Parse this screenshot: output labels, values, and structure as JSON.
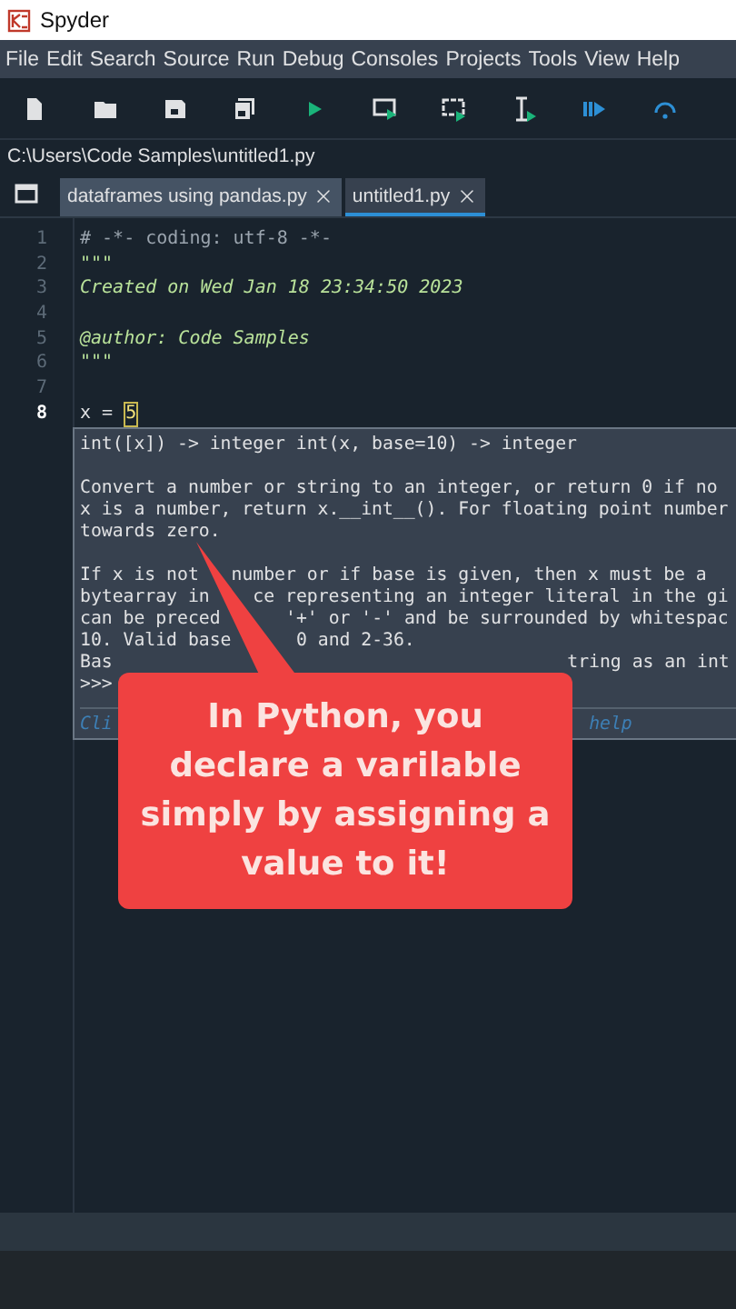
{
  "window": {
    "title": "Spyder"
  },
  "menu": [
    "File",
    "Edit",
    "Search",
    "Source",
    "Run",
    "Debug",
    "Consoles",
    "Projects",
    "Tools",
    "View",
    "Help"
  ],
  "toolbar": [
    {
      "kind": "new-file"
    },
    {
      "kind": "open"
    },
    {
      "kind": "save"
    },
    {
      "kind": "save-all"
    },
    {
      "kind": "run"
    },
    {
      "kind": "run-cell"
    },
    {
      "kind": "run-cell-advance"
    },
    {
      "kind": "run-selection"
    },
    {
      "kind": "debug"
    },
    {
      "kind": "step"
    }
  ],
  "path": "C:\\Users\\Code Samples\\untitled1.py",
  "tabs": [
    {
      "label": "dataframes using pandas.py",
      "selected": false
    },
    {
      "label": "untitled1.py",
      "selected": true
    }
  ],
  "editor": {
    "lines": [
      {
        "number": "1",
        "current": false,
        "tokens": [
          {
            "kind": "comment",
            "text": "# -*- coding: utf-8 -*-"
          }
        ]
      },
      {
        "number": "2",
        "current": false,
        "tokens": [
          {
            "kind": "docstring",
            "text": "\"\"\""
          }
        ]
      },
      {
        "number": "3",
        "current": false,
        "tokens": [
          {
            "kind": "docstring",
            "text": "Created on Wed Jan 18 23:34:50 2023"
          }
        ]
      },
      {
        "number": "4",
        "current": false
      },
      {
        "number": "5",
        "current": false,
        "tokens": [
          {
            "kind": "docstring",
            "text": "@author: Code Samples"
          }
        ]
      },
      {
        "number": "6",
        "current": false,
        "tokens": [
          {
            "kind": "docstring",
            "text": "\"\"\""
          }
        ]
      },
      {
        "number": "7",
        "current": false
      },
      {
        "number": "8",
        "current": true,
        "tokens": [
          {
            "kind": "code",
            "text": "x = "
          },
          {
            "kind": "number",
            "text": "5"
          }
        ]
      }
    ]
  },
  "tooltip": {
    "signature": "int([x]) -> integer int(x, base=10) -> integer",
    "paragraphs": [
      [
        [
          "Convert a number or string to an integer, or return 0 if no"
        ],
        [
          "x is a number, return x.__int__(). For floating point number"
        ],
        [
          "towards zero."
        ]
      ],
      [
        [
          "If x is not",
          "number or if base is given, then x must be a"
        ],
        [
          "bytearray in",
          "ce representing an integer literal in the gi"
        ],
        [
          "can be preced",
          "'+' or '-' and be surrounded by whitespac"
        ],
        [
          "10. Valid base",
          "0 and 2-36."
        ],
        [
          "Bas",
          "tring as an int"
        ],
        [
          ">>>"
        ]
      ]
    ],
    "footer": [
      "Cli",
      "help"
    ]
  },
  "callout": {
    "text": "In Python, you declare a varilable simply by assigning a value to it!"
  }
}
